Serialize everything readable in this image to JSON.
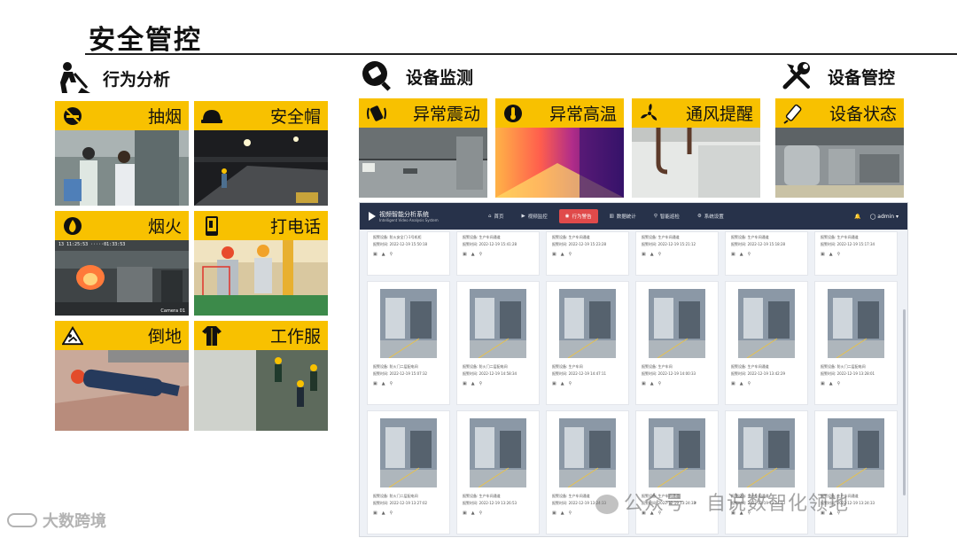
{
  "slide": {
    "title": "安全管控"
  },
  "sections": {
    "behavior": {
      "label": "行为分析",
      "icon": "worker-digging-icon"
    },
    "monitor": {
      "label": "设备监测",
      "icon": "magnifier-tool-icon"
    },
    "control": {
      "label": "设备管控",
      "icon": "wrench-screwdriver-icon"
    }
  },
  "behavior_tiles": [
    {
      "label": "抽烟",
      "icon": "no-smoking-icon"
    },
    {
      "label": "安全帽",
      "icon": "hardhat-icon"
    },
    {
      "label": "烟火",
      "icon": "fire-icon"
    },
    {
      "label": "打电话",
      "icon": "phone-icon"
    },
    {
      "label": "倒地",
      "icon": "fall-warning-icon"
    },
    {
      "label": "工作服",
      "icon": "uniform-icon"
    }
  ],
  "tile_overlays": {
    "fire_timestamp": "13 11:25:53 ·····01:33:53",
    "fire_cam": "Camera 01"
  },
  "monitor_tiles": [
    {
      "label": "异常震动",
      "icon": "vibration-icon"
    },
    {
      "label": "异常高温",
      "icon": "thermometer-icon"
    },
    {
      "label": "通风提醒",
      "icon": "fan-icon"
    }
  ],
  "control_tiles": [
    {
      "label": "设备状态",
      "icon": "pen-tool-icon"
    }
  ],
  "app": {
    "name": "视频智能分析系统",
    "subtitle": "Intelligent Video Analysis System",
    "nav": [
      "首页",
      "视频监控",
      "行为警告",
      "数据统计",
      "智能巡检",
      "系统设置"
    ],
    "active_nav": 2,
    "user": "admin",
    "meta_top": [
      [
        "报警设备: 防火安全门-1号机柜",
        "报警时间: 2022-12-19 15:50:18"
      ],
      [
        "报警设备: 生产车间通道",
        "报警时间: 2022-12-19 15:41:28"
      ],
      [
        "报警设备: 生产车间通道",
        "报警时间: 2022-12-19 15:23:28"
      ],
      [
        "报警设备: 生产车间通道",
        "报警时间: 2022-12-19 15:21:12"
      ],
      [
        "报警设备: 生产车间通道",
        "报警时间: 2022-12-19 15:18:28"
      ],
      [
        "报警设备: 生产车间通道",
        "报警时间: 2022-12-19 15:17:34"
      ]
    ],
    "meta_mid": [
      [
        "报警设备: 防火门二层配电间",
        "报警时间: 2022-12-19 15:07:32"
      ],
      [
        "报警设备: 防火门二层配电间",
        "报警时间: 2022-12-19 14:58:34"
      ],
      [
        "报警设备: 生产车间",
        "报警时间: 2022-12-19 14:47:11"
      ],
      [
        "报警设备: 生产车间",
        "报警时间: 2022-12-19 14:00:33"
      ],
      [
        "报警设备: 生产车间通道",
        "报警时间: 2022-12-19 13:42:29"
      ],
      [
        "报警设备: 防火门二层配电间",
        "报警时间: 2022-12-19 13:28:01"
      ]
    ],
    "meta_bot": [
      [
        "报警设备: 防火门二层配电间",
        "报警时间: 2022-12-19 13:27:02"
      ],
      [
        "报警设备: 生产车间通道",
        "报警时间: 2022-12-19 13:26:53"
      ],
      [
        "报警设备: 生产车间通道",
        "报警时间: 2022-12-19 13:24:33"
      ],
      [
        "报警设备: 生产车间通道",
        "报警时间: 2022-12-19 13:24:33"
      ],
      [
        "报警设备: 生产车间通道",
        "报警时间: 2022-12-19 13:24:33"
      ],
      [
        "报警设备: 生产车间通道",
        "报警时间: 2022-12-19 13:24:33"
      ]
    ]
  },
  "watermarks": {
    "wechat": "公众号 · 自说数智化领地",
    "corner": "大数跨境"
  },
  "colors": {
    "accent": "#f8c100",
    "app_header": "#27324a",
    "nav_active": "#e04a4a"
  }
}
